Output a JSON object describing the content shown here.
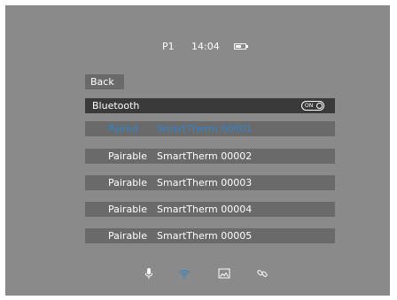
{
  "status_bar": {
    "page": "P1",
    "time": "14:04",
    "battery_level": 0.6
  },
  "back_label": "Back",
  "bluetooth": {
    "label": "Bluetooth",
    "toggle_text": "ON"
  },
  "devices": [
    {
      "status": "Paired",
      "name": "SmartTherm 00001"
    },
    {
      "status": "Pairable",
      "name": "SmartTherm 00002"
    },
    {
      "status": "Pairable",
      "name": "SmartTherm 00003"
    },
    {
      "status": "Pairable",
      "name": "SmartTherm 00004"
    },
    {
      "status": "Pairable",
      "name": "SmartTherm 00005"
    }
  ],
  "bottom_icons": [
    "microphone-icon",
    "wifi-icon",
    "image-icon",
    "link-icon"
  ],
  "colors": {
    "background": "#8a8a8a",
    "row": "#6a6a6a",
    "bluetooth_row": "#3a3a3a",
    "accent": "#2f84d2"
  }
}
